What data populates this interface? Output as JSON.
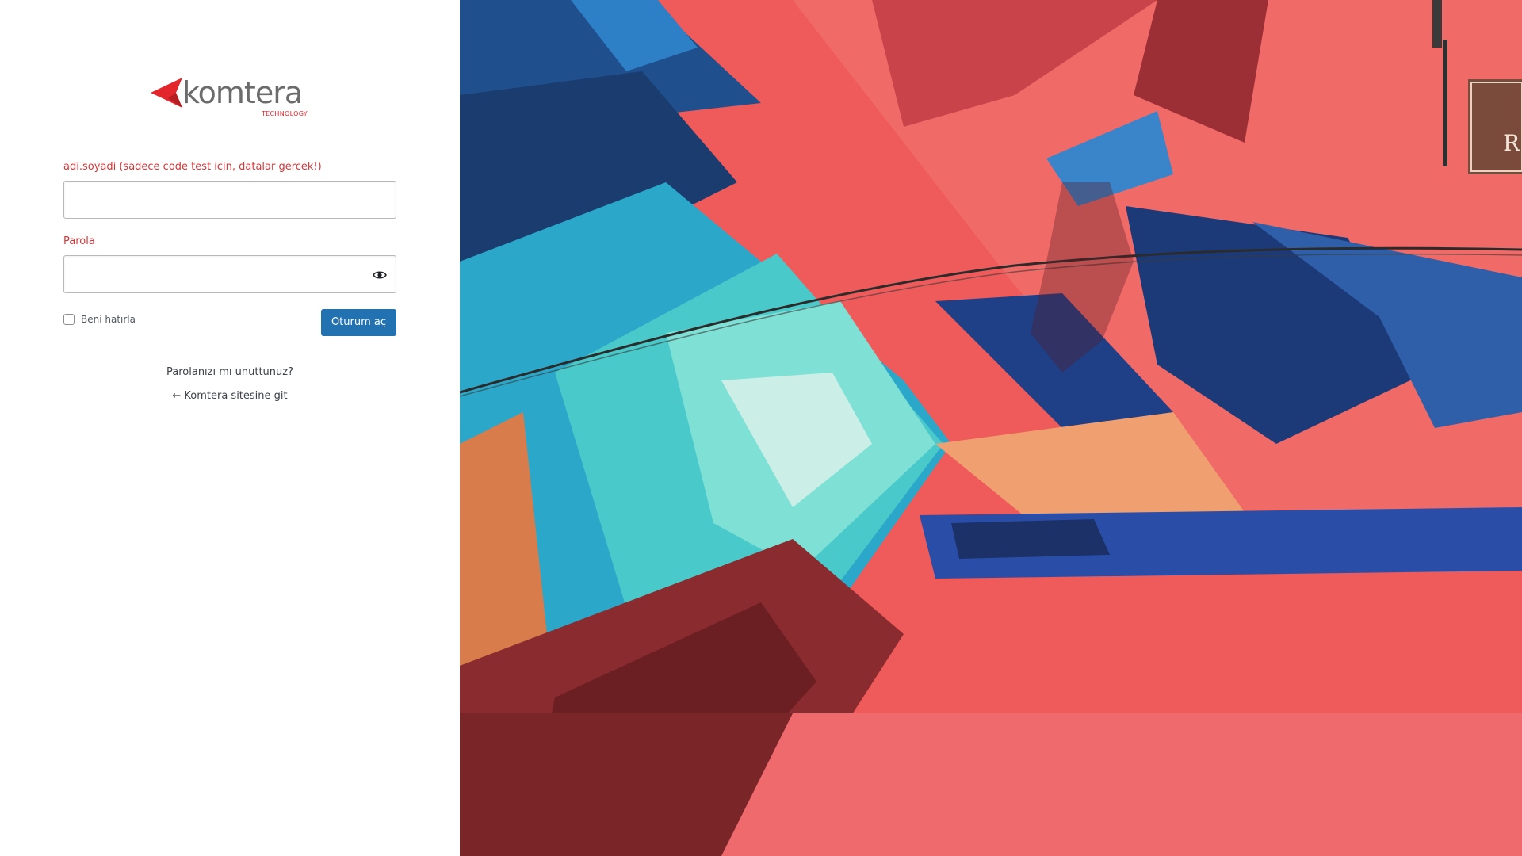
{
  "brand": {
    "name": "komtera",
    "tagline": "TECHNOLOGY",
    "accent_color": "#e3262c",
    "text_color": "#6b6b6b"
  },
  "login": {
    "username_label": "adi.soyadi (sadece code test icin, datalar gercek!)",
    "username_value": "",
    "password_label": "Parola",
    "password_value": "",
    "show_password_icon": "eye-icon",
    "remember_label": "Beni hatırla",
    "remember_checked": false,
    "submit_label": "Oturum aç",
    "label_color": "#d63638",
    "button_color": "#2271b1"
  },
  "links": {
    "forgot_password": "Parolanızı mı unuttunuz?",
    "back_to_site": "← Komtera sitesine git"
  },
  "background": {
    "description_icon": "graffiti-artwork",
    "sign_text": "R"
  }
}
